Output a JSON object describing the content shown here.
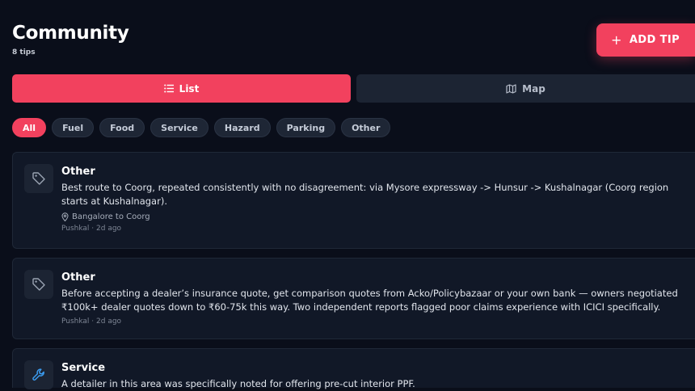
{
  "header": {
    "title": "Community",
    "subtitle": "8 tips"
  },
  "add_tip": {
    "plus": "+",
    "label": "ADD TIP"
  },
  "view_toggle": {
    "list_label": "List",
    "map_label": "Map",
    "selected": "List"
  },
  "filters": {
    "selected": "All",
    "items": [
      "All",
      "Fuel",
      "Food",
      "Service",
      "Hazard",
      "Parking",
      "Other"
    ]
  },
  "tips": [
    {
      "category": "Other",
      "icon": "tag-icon",
      "text": "Best route to Coorg, repeated consistently with no disagreement: via Mysore expressway -> Hunsur -> Kushalnagar (Coorg region starts at Kushalnagar).",
      "location": "Bangalore to Coorg",
      "meta": "Pushkal · 2d ago"
    },
    {
      "category": "Other",
      "icon": "tag-icon",
      "text": "Before accepting a dealer’s insurance quote, get comparison quotes from Acko/Policybazaar or your own bank — owners negotiated ₹100k+ dealer quotes down to ₹60-75k this way. Two independent reports flagged poor claims experience with ICICI specifically.",
      "location": "",
      "meta": "Pushkal · 2d ago"
    },
    {
      "category": "Service",
      "icon": "wrench-icon",
      "text": "A detailer in this area was specifically noted for offering pre-cut interior PPF.",
      "location": "",
      "meta": ""
    }
  ],
  "colors": {
    "background": "#0a0e1a",
    "accent": "#f2415e",
    "card": "#111827",
    "chip": "#1e2635"
  }
}
